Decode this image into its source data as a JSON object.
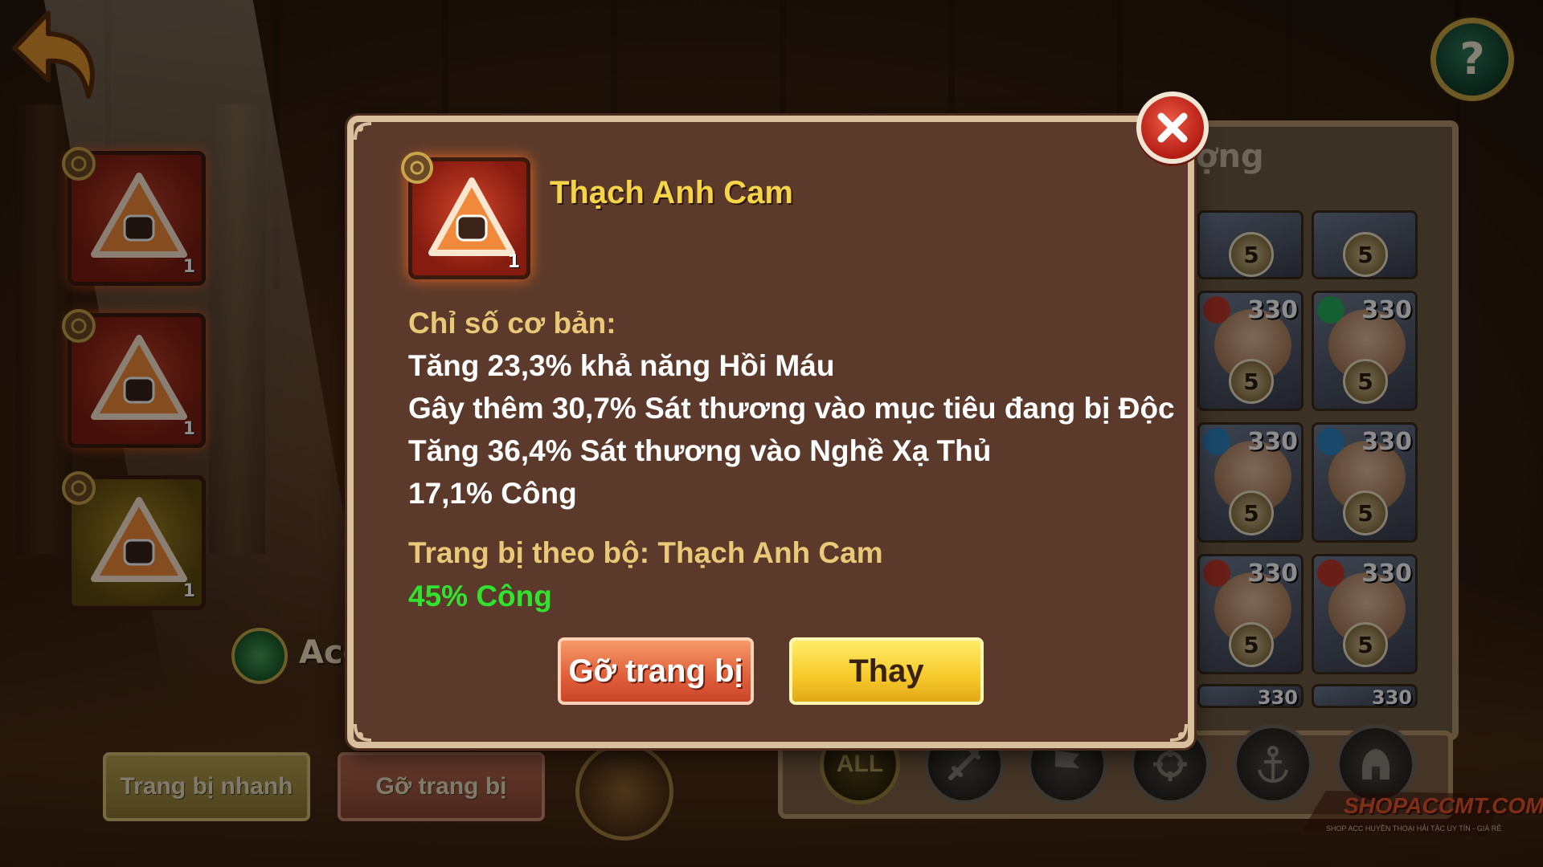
{
  "colors": {
    "modal_bg": "#5b3a2c",
    "modal_border": "#d8c09c",
    "title_yellow": "#f5d447",
    "section_gold": "#e9c877",
    "set_bonus_green": "#31e22f",
    "remove_button": "#e05e3a",
    "replace_button": "#f7c92a"
  },
  "icons": [
    "back-arrow-icon",
    "help-icon",
    "close-icon",
    "fist-triangle-icon",
    "target-icon",
    "eye-icon",
    "sword-icon",
    "flag-icon",
    "crosshair-icon",
    "anchor-icon",
    "helmet-icon"
  ],
  "header": {
    "help_label": "?"
  },
  "equipment_slots": [
    {
      "count": "1"
    },
    {
      "count": "1"
    },
    {
      "count": "1"
    }
  ],
  "character": {
    "name": "Ace"
  },
  "bottom_buttons": {
    "quick_equip": "Trang bị nhanh",
    "unequip": "Gỡ trang bị"
  },
  "hero_list": {
    "title_partial": "ợng",
    "heroes": [
      {
        "level": "",
        "stars": "5"
      },
      {
        "level": "",
        "stars": "5"
      },
      {
        "level": "330",
        "stars": "5"
      },
      {
        "level": "330",
        "stars": "5"
      },
      {
        "level": "330",
        "stars": "5"
      },
      {
        "level": "330",
        "stars": "5"
      },
      {
        "level": "330",
        "stars": "5"
      },
      {
        "level": "330",
        "stars": "5"
      },
      {
        "level": "330",
        "stars": ""
      },
      {
        "level": "330",
        "stars": ""
      }
    ]
  },
  "filters": [
    "ALL",
    "sword",
    "flag",
    "crosshair",
    "anchor",
    "helmet"
  ],
  "modal": {
    "item_name": "Thạch Anh Cam",
    "item_count": "1",
    "base_stats_label": "Chỉ số cơ bản:",
    "stats": [
      "Tăng 23,3% khả năng Hồi Máu",
      "Gây thêm 30,7% Sát thương vào mục tiêu đang bị Độc",
      "Tăng 36,4% Sát thương vào Nghề Xạ Thủ",
      "17,1% Công"
    ],
    "set_label": "Trang bị theo bộ: Thạch Anh Cam",
    "set_bonus": "45% Công",
    "remove_button": "Gỡ trang bị",
    "replace_button": "Thay"
  },
  "watermark": {
    "brand": "SHOPACCMT.COM",
    "tagline": "SHOP ACC HUYỀN THOẠI HẢI TẶC UY TÍN - GIÁ RẺ"
  }
}
